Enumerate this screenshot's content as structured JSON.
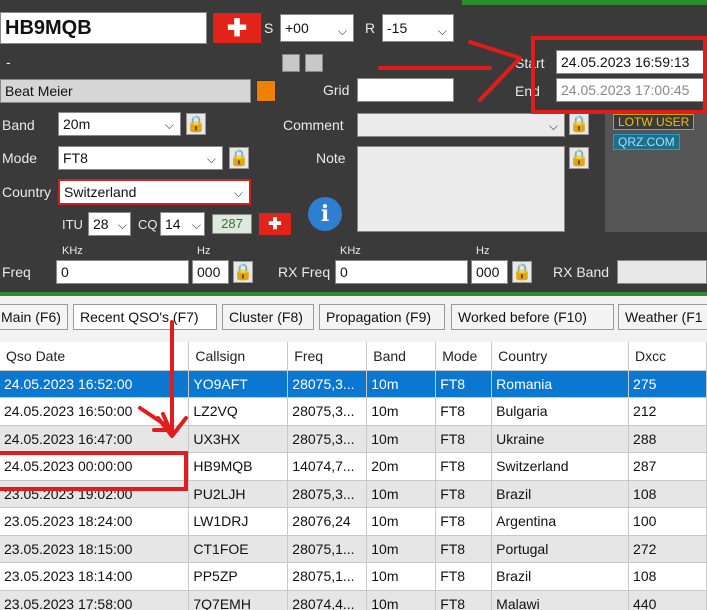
{
  "callsign": "HB9MQB",
  "sent_label": "S",
  "sent_value": "+00",
  "rcvd_label": "R",
  "rcvd_value": "-15",
  "dash": "-",
  "name": "Beat Meier",
  "grid_label": "Grid",
  "grid_value": "",
  "start_label": "Start",
  "start_value": "24.05.2023 16:59:13",
  "end_label": "End",
  "end_value": "24.05.2023 17:00:45",
  "band_label": "Band",
  "band_value": "20m",
  "comment_label": "Comment",
  "mode_label": "Mode",
  "mode_value": "FT8",
  "note_label": "Note",
  "country_label": "Country",
  "country_value": "Switzerland",
  "itu_label": "ITU",
  "itu_value": "28",
  "cq_label": "CQ",
  "cq_value": "14",
  "dxcc_value": "287",
  "lotw_label": "LOTW USER",
  "qrz_label": "QRZ.COM",
  "khz_label": "KHz",
  "hz_label": "Hz",
  "freq_label": "Freq",
  "freq_khz": "0",
  "freq_hz": "000",
  "rxfreq_label": "RX Freq",
  "rxfreq_khz": "0",
  "rxfreq_hz": "000",
  "rxband_label": "RX Band",
  "tabs": [
    "Main (F6)",
    "Recent QSO's (F7)",
    "Cluster (F8)",
    "Propagation (F9)",
    "Worked before (F10)",
    "Weather (F1"
  ],
  "columns": [
    "Qso Date",
    "Callsign",
    "Freq",
    "Band",
    "Mode",
    "Country",
    "Dxcc"
  ],
  "rows": [
    [
      "24.05.2023 16:52:00",
      "YO9AFT",
      "28075,3...",
      "10m",
      "FT8",
      "Romania",
      "275"
    ],
    [
      "24.05.2023 16:50:00",
      "LZ2VQ",
      "28075,3...",
      "10m",
      "FT8",
      "Bulgaria",
      "212"
    ],
    [
      "24.05.2023 16:47:00",
      "UX3HX",
      "28075,3...",
      "10m",
      "FT8",
      "Ukraine",
      "288"
    ],
    [
      "24.05.2023 00:00:00",
      "HB9MQB",
      "14074,7...",
      "20m",
      "FT8",
      "Switzerland",
      "287"
    ],
    [
      "23.05.2023 19:02:00",
      "PU2LJH",
      "28075,3...",
      "10m",
      "FT8",
      "Brazil",
      "108"
    ],
    [
      "23.05.2023 18:24:00",
      "LW1DRJ",
      "28076,24",
      "10m",
      "FT8",
      "Argentina",
      "100"
    ],
    [
      "23.05.2023 18:15:00",
      "CT1FOE",
      "28075,1...",
      "10m",
      "FT8",
      "Portugal",
      "272"
    ],
    [
      "23.05.2023 18:14:00",
      "PP5ZP",
      "28075,1...",
      "10m",
      "FT8",
      "Brazil",
      "108"
    ],
    [
      "23.05.2023 17:58:00",
      "7Q7EMH",
      "28074,4...",
      "10m",
      "FT8",
      "Malawi",
      "440"
    ]
  ],
  "colors": {
    "panel": "#3a3a3a",
    "selected_row": "#0a78d0",
    "annotation": "#e01c1c",
    "lotw": "#c8a000",
    "qrz": "#2a9ac8"
  }
}
